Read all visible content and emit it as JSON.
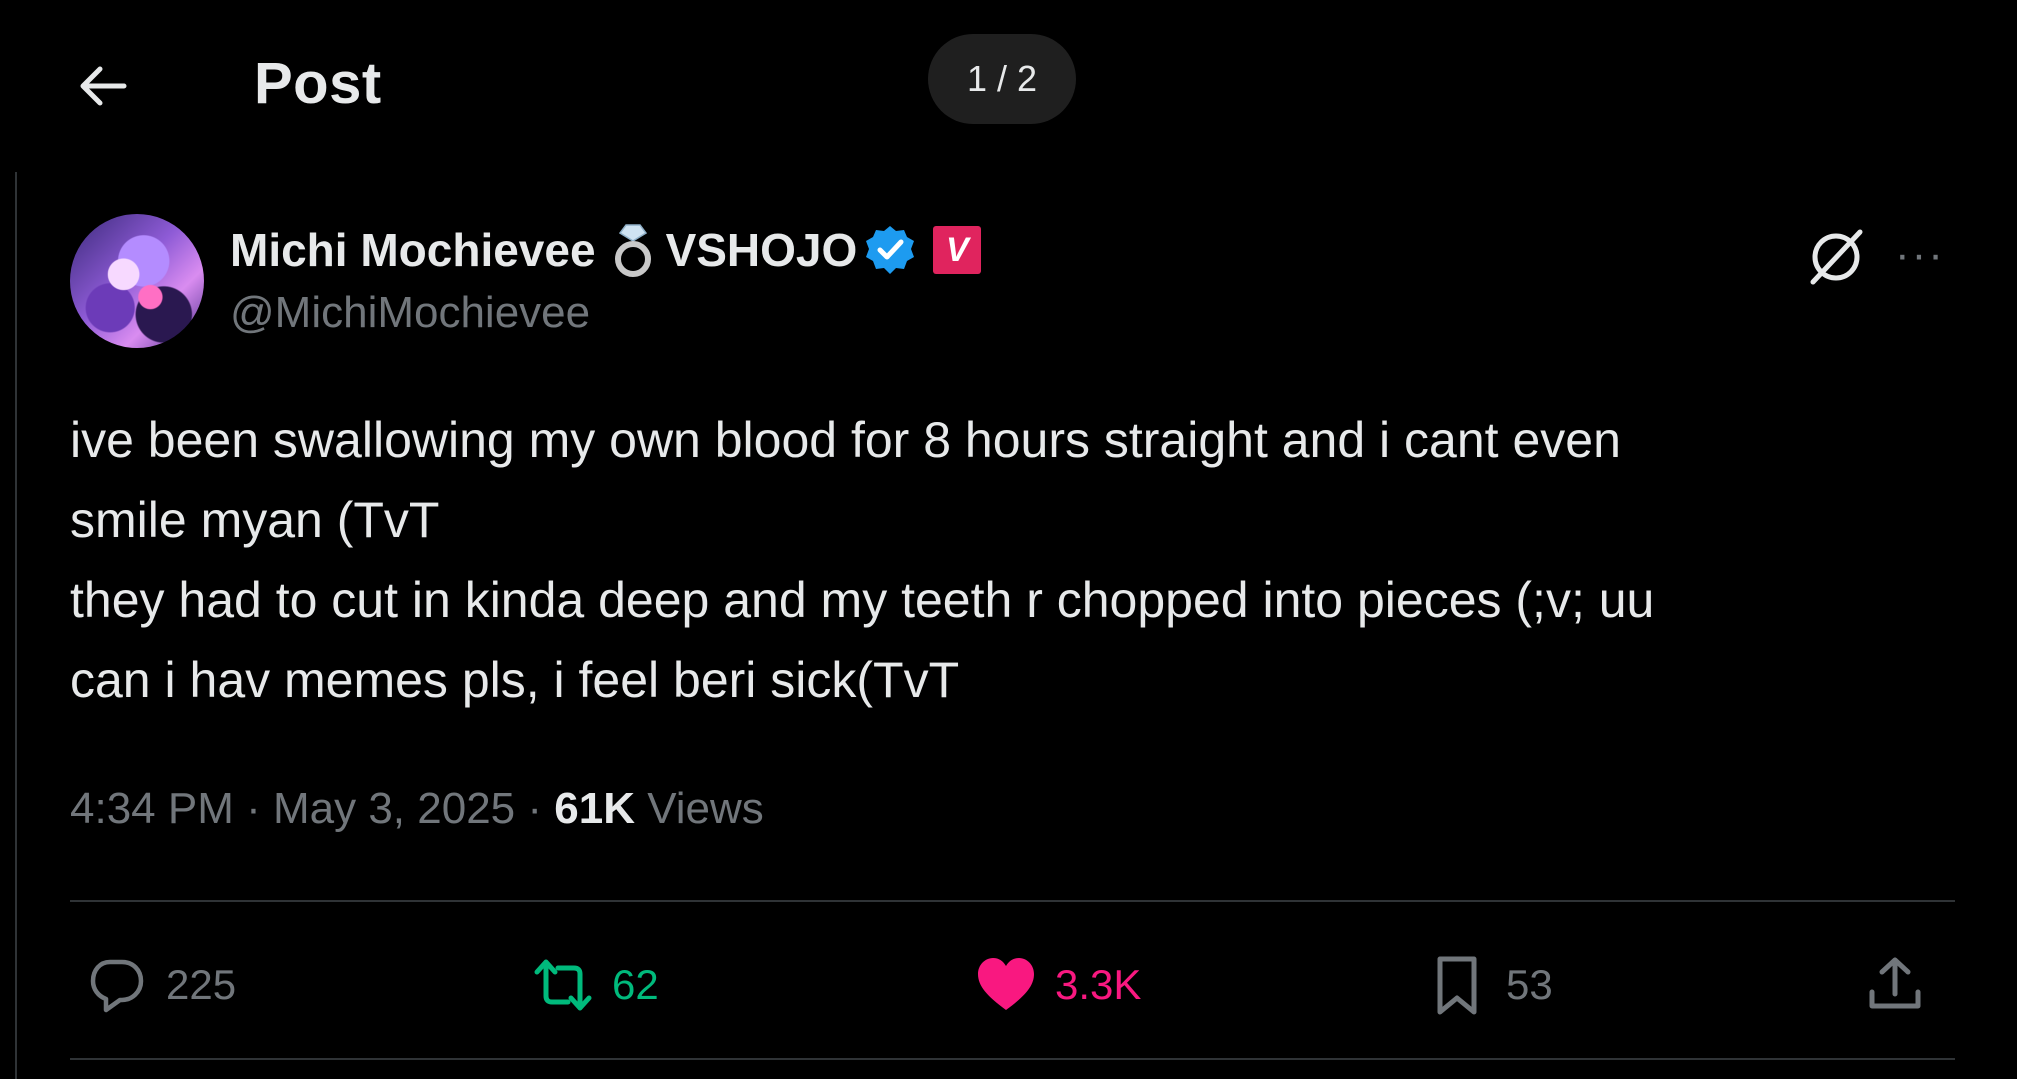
{
  "header": {
    "back_icon": "arrow-left-icon",
    "title": "Post",
    "media_counter": "1 / 2"
  },
  "post": {
    "author": {
      "display_name": "Michi Mochievee",
      "ring_emoji": "ring-icon",
      "org_name": "VSHOJO",
      "verified_icon": "verified-badge-icon",
      "org_badge_letter": "V",
      "handle": "@MichiMochievee"
    },
    "text_lines": [
      "ive been swallowing my own blood for 8 hours straight and i cant even",
      "smile myan (TvT",
      "they had to cut in kinda deep and my teeth r chopped into pieces (;v; uu",
      "can i hav memes pls, i feel beri sick(TvT"
    ],
    "meta": {
      "time": "4:34 PM",
      "separator": " · ",
      "date": "May 3, 2025",
      "views_count": "61K",
      "views_label": " Views"
    },
    "actions": {
      "replies": "225",
      "reposts": "62",
      "likes": "3.3K",
      "bookmarks": "53"
    }
  },
  "colors": {
    "background": "#000000",
    "text": "#e7e9ea",
    "muted": "#71767b",
    "repost": "#00ba7c",
    "like": "#f91880",
    "verified": "#1d9bf0",
    "org_badge": "#e0245e"
  }
}
